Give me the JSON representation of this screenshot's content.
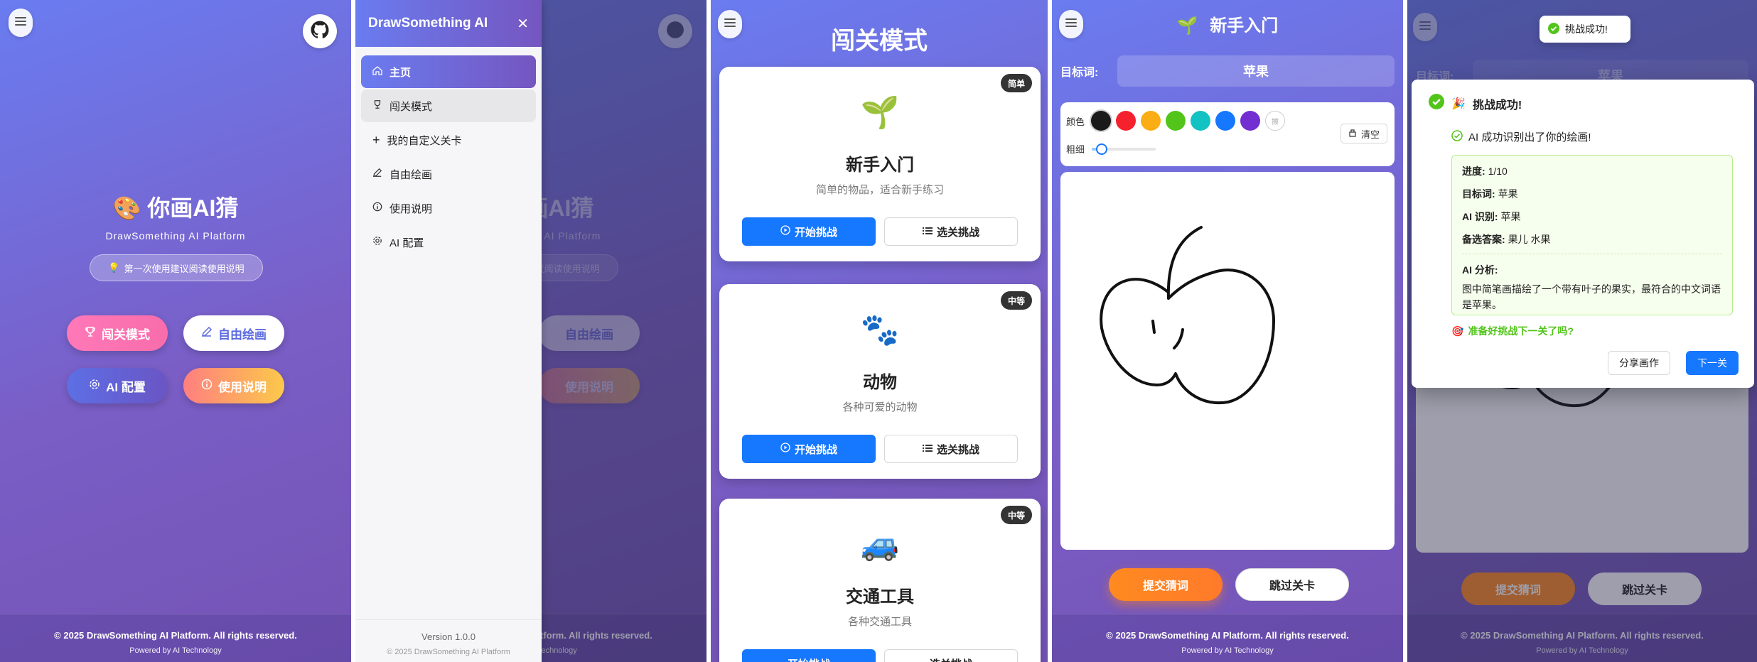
{
  "screen1": {
    "title": "你画AI猜",
    "subtitle": "DrawSomething AI Platform",
    "hint": "第一次使用建议阅读使用说明",
    "buttons": {
      "level_mode": "闯关模式",
      "free_draw": "自由绘画",
      "ai_config": "AI 配置",
      "instructions": "使用说明"
    },
    "footer": {
      "copyright": "© 2025 DrawSomething AI Platform. All rights reserved.",
      "powered": "Powered by AI Technology"
    }
  },
  "screen2": {
    "sidebar_title": "DrawSomething AI",
    "menu": [
      {
        "label": "主页",
        "icon": "home-icon"
      },
      {
        "label": "闯关模式",
        "icon": "trophy-icon"
      },
      {
        "label": "我的自定义关卡",
        "icon": "plus-icon"
      },
      {
        "label": "自由绘画",
        "icon": "pencil-icon"
      },
      {
        "label": "使用说明",
        "icon": "info-icon"
      },
      {
        "label": "AI 配置",
        "icon": "gear-icon"
      }
    ],
    "version": "Version 1.0.0",
    "copyright": "© 2025 DrawSomething AI Platform"
  },
  "screen3": {
    "title": "闯关模式",
    "cards": [
      {
        "emoji": "🌱",
        "name": "新手入门",
        "desc": "简单的物品，适合新手练习",
        "difficulty": "简单"
      },
      {
        "emoji": "🐾",
        "name": "动物",
        "desc": "各种可爱的动物",
        "difficulty": "中等"
      },
      {
        "emoji": "🚙",
        "name": "交通工具",
        "desc": "各种交通工具",
        "difficulty": "中等"
      }
    ],
    "start_label": "开始挑战",
    "select_label": "选关挑战"
  },
  "screen4": {
    "level_emoji": "🌱",
    "level_name": "新手入门",
    "target_label": "目标词:",
    "target_word": "苹果",
    "color_label": "颜色",
    "thickness_label": "粗细",
    "clear_label": "清空",
    "colors": [
      "#1a1a1a",
      "#f5222d",
      "#faad14",
      "#52c41a",
      "#13c2c2",
      "#1677ff",
      "#722ed1"
    ],
    "submit_label": "提交猜词",
    "skip_label": "跳过关卡"
  },
  "screen5": {
    "toast": "挑战成功!",
    "modal_title": "挑战成功!",
    "recognized": "AI 成功识别出了你的绘画!",
    "progress_label": "进度:",
    "progress_value": "1/10",
    "target_label": "目标词:",
    "target_value": "苹果",
    "ai_label": "AI 识别:",
    "ai_value": "苹果",
    "alt_label": "备选答案:",
    "alt_value": "果儿 水果",
    "analysis_label": "AI 分析:",
    "analysis_text": "图中简笔画描绘了一个带有叶子的果实，最符合的中文词语是苹果。",
    "next_prompt": "准备好挑战下一关了吗?",
    "share_label": "分享画作",
    "next_label": "下一关"
  }
}
